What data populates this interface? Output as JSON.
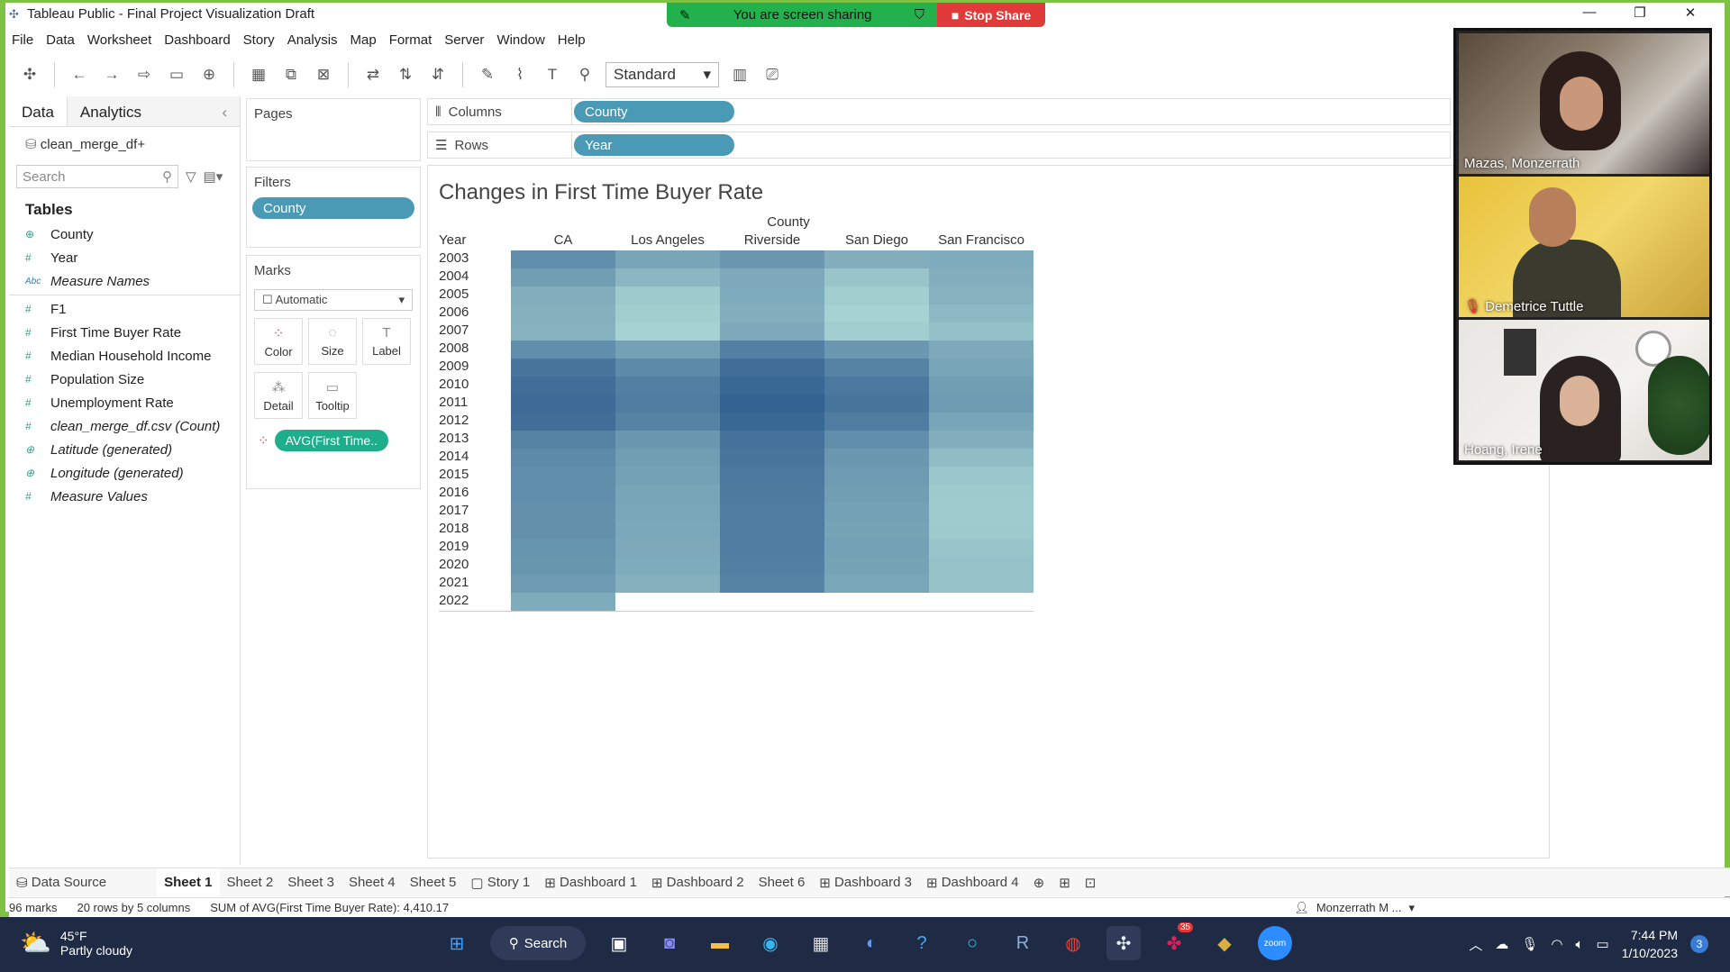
{
  "window": {
    "title": "Tableau Public - Final Project Visualization Draft"
  },
  "share": {
    "status": "You are screen sharing",
    "stop": "Stop Share"
  },
  "menu": [
    "File",
    "Data",
    "Worksheet",
    "Dashboard",
    "Story",
    "Analysis",
    "Map",
    "Format",
    "Server",
    "Window",
    "Help"
  ],
  "toolbar": {
    "fit_select": "Standard"
  },
  "datapane": {
    "tab_data": "Data",
    "tab_analytics": "Analytics",
    "datasource": "clean_merge_df+",
    "search_placeholder": "Search",
    "tables_heading": "Tables",
    "fields": [
      {
        "name": "County",
        "type": "geo",
        "italic": false
      },
      {
        "name": "Year",
        "type": "measure",
        "italic": false
      },
      {
        "name": "Measure Names",
        "type": "abc",
        "italic": true
      },
      {
        "name": "F1",
        "type": "measure",
        "italic": false
      },
      {
        "name": "First Time Buyer Rate",
        "type": "measure",
        "italic": false
      },
      {
        "name": "Median Household Income",
        "type": "measure",
        "italic": false
      },
      {
        "name": "Population Size",
        "type": "measure",
        "italic": false
      },
      {
        "name": "Unemployment Rate",
        "type": "measure",
        "italic": false
      },
      {
        "name": "clean_merge_df.csv (Count)",
        "type": "measure",
        "italic": true
      },
      {
        "name": "Latitude (generated)",
        "type": "geo",
        "italic": true
      },
      {
        "name": "Longitude (generated)",
        "type": "geo",
        "italic": true
      },
      {
        "name": "Measure Values",
        "type": "measure",
        "italic": true
      }
    ]
  },
  "cards": {
    "pages": "Pages",
    "filters": "Filters",
    "filter_pill": "County",
    "marks": "Marks",
    "mark_type": "Automatic",
    "mark_buttons": [
      "Color",
      "Size",
      "Label",
      "Detail",
      "Tooltip"
    ],
    "avg_pill": "AVG(First Time.."
  },
  "shelves": {
    "columns_label": "Columns",
    "columns_pill": "County",
    "rows_label": "Rows",
    "rows_pill": "Year"
  },
  "chart_data": {
    "type": "heatmap",
    "title": "Changes in First Time Buyer Rate",
    "column_header": "County",
    "row_header": "Year",
    "categories": [
      "CA",
      "Los Angeles",
      "Riverside",
      "San Diego",
      "San Francisco"
    ],
    "years": [
      "2003",
      "2004",
      "2005",
      "2006",
      "2007",
      "2008",
      "2009",
      "2010",
      "2011",
      "2012",
      "2013",
      "2014",
      "2015",
      "2016",
      "2017",
      "2018",
      "2019",
      "2020",
      "2021",
      "2022"
    ],
    "color_scale": {
      "low": "#b7e2dc",
      "high": "#2c5a8c"
    },
    "values": [
      [
        0.62,
        0.45,
        0.55,
        0.38,
        0.4
      ],
      [
        0.5,
        0.32,
        0.42,
        0.22,
        0.38
      ],
      [
        0.38,
        0.18,
        0.4,
        0.15,
        0.35
      ],
      [
        0.36,
        0.15,
        0.38,
        0.12,
        0.3
      ],
      [
        0.35,
        0.12,
        0.42,
        0.15,
        0.25
      ],
      [
        0.62,
        0.48,
        0.72,
        0.55,
        0.42
      ],
      [
        0.8,
        0.65,
        0.85,
        0.7,
        0.45
      ],
      [
        0.85,
        0.72,
        0.9,
        0.78,
        0.5
      ],
      [
        0.88,
        0.75,
        0.95,
        0.8,
        0.52
      ],
      [
        0.85,
        0.7,
        0.9,
        0.75,
        0.45
      ],
      [
        0.7,
        0.55,
        0.82,
        0.62,
        0.38
      ],
      [
        0.65,
        0.5,
        0.8,
        0.55,
        0.28
      ],
      [
        0.62,
        0.48,
        0.78,
        0.52,
        0.2
      ],
      [
        0.62,
        0.45,
        0.76,
        0.5,
        0.18
      ],
      [
        0.6,
        0.44,
        0.75,
        0.48,
        0.17
      ],
      [
        0.6,
        0.43,
        0.75,
        0.46,
        0.18
      ],
      [
        0.58,
        0.42,
        0.74,
        0.48,
        0.22
      ],
      [
        0.56,
        0.4,
        0.73,
        0.46,
        0.24
      ],
      [
        0.52,
        0.36,
        0.7,
        0.44,
        0.24
      ],
      [
        0.4,
        null,
        null,
        null,
        null
      ]
    ]
  },
  "participants": [
    "Mazas, Monzerrath",
    "Demetrice Tuttle",
    "Hoang, Irene"
  ],
  "sheet_tabs": [
    "Data Source",
    "Sheet 1",
    "Sheet 2",
    "Sheet 3",
    "Sheet 4",
    "Sheet 5",
    "Story 1",
    "Dashboard 1",
    "Dashboard 2",
    "Sheet 6",
    "Dashboard 3",
    "Dashboard 4"
  ],
  "status": {
    "marks": "96 marks",
    "dims": "20 rows by 5 columns",
    "sum": "SUM of AVG(First Time Buyer Rate): 4,410.17",
    "user": "Monzerrath M ..."
  },
  "taskbar": {
    "temp": "45°F",
    "weather": "Partly cloudy",
    "search": "Search",
    "time": "7:44 PM",
    "date": "1/10/2023",
    "badge": "35",
    "notif": "3"
  }
}
